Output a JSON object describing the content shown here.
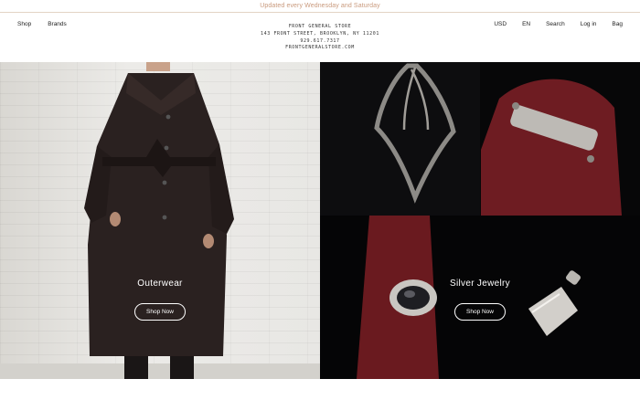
{
  "announcement": "Updated every Wednesday and Saturday",
  "nav_left": [
    "Shop",
    "Brands"
  ],
  "nav_right": [
    "USD",
    "EN",
    "Search",
    "Log in",
    "Bag"
  ],
  "store": {
    "name": "FRONT GENERAL STORE",
    "address": "143 FRONT STREET, BROOKLYN, NY 11201",
    "phone": "929.617.7317",
    "website": "FRONTGENERALSTORE.COM"
  },
  "panels": [
    {
      "title": "Outerwear",
      "button": "Shop Now"
    },
    {
      "title": "Silver Jewelry",
      "button": "Shop Now"
    }
  ],
  "colors": {
    "announce_text": "#c99a7d",
    "divider": "#e3d4c4",
    "panel_right_bg": "#0b0b0d",
    "burgundy": "#6e1c22"
  }
}
